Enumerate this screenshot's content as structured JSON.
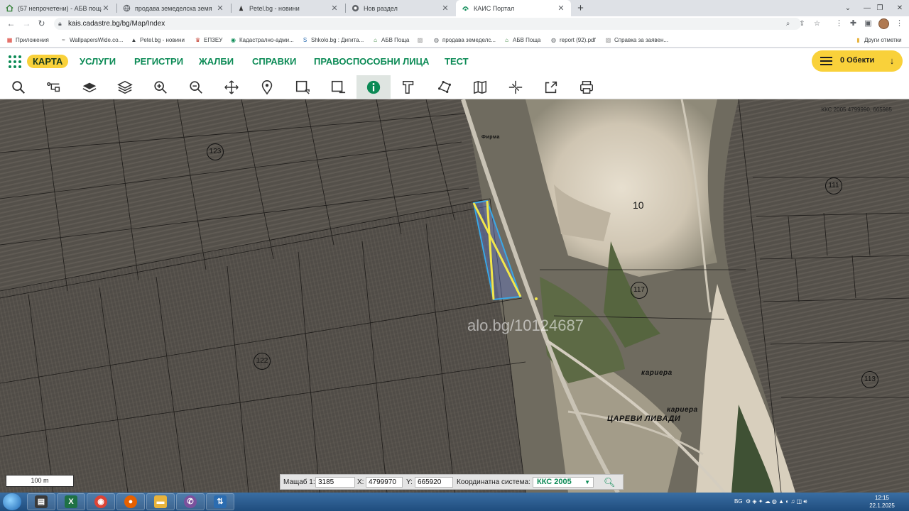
{
  "tabs": [
    {
      "title": "(57 непрочетени) - АБВ поща",
      "icon": "abv-house-icon"
    },
    {
      "title": "продава земеделска земя",
      "icon": "globe-icon"
    },
    {
      "title": "Petel.bg - новини",
      "icon": "petel-icon"
    },
    {
      "title": "Нов раздел",
      "icon": "chrome-icon"
    },
    {
      "title": "КАИС Портал",
      "icon": "kais-icon",
      "active": true
    }
  ],
  "new_tab_label": "+",
  "address": {
    "url": "kais.cadastre.bg/bg/Map/Index"
  },
  "bookmarks": [
    {
      "label": "Приложения",
      "icon": "apps-grid-icon"
    },
    {
      "label": "WallpapersWide.co...",
      "icon": "wallpaper-icon"
    },
    {
      "label": "Petel.bg - новини",
      "icon": "petel-icon"
    },
    {
      "label": "ЕПЗЕУ",
      "icon": "epzeu-icon"
    },
    {
      "label": "Кадастрално-адми...",
      "icon": "cadastre-icon"
    },
    {
      "label": "Shkolo.bg : Дигита...",
      "icon": "shkolo-icon"
    },
    {
      "label": "АБВ Поща",
      "icon": "abv-house-icon"
    },
    {
      "label": "",
      "icon": "broken-image-icon"
    },
    {
      "label": "продава земеделс...",
      "icon": "globe-icon"
    },
    {
      "label": "АБВ Поща",
      "icon": "abv-house-icon"
    },
    {
      "label": "report (92).pdf",
      "icon": "globe-icon"
    },
    {
      "label": "Справка за заявен...",
      "icon": "broken-image-icon"
    }
  ],
  "other_bookmarks": "Други отметки",
  "menu": [
    {
      "label": "КАРТА",
      "active": true
    },
    {
      "label": "УСЛУГИ"
    },
    {
      "label": "РЕГИСТРИ"
    },
    {
      "label": "ЖАЛБИ"
    },
    {
      "label": "СПРАВКИ"
    },
    {
      "label": "ПРАВОСПОСОБНИ ЛИЦА"
    },
    {
      "label": "ТЕСТ"
    }
  ],
  "objects_button": "0 Обекти",
  "tools": [
    "search-icon",
    "layer-tree-icon",
    "layers-icon",
    "layers-stack-icon",
    "zoom-in-icon",
    "zoom-out-icon",
    "pan-arrows-icon",
    "location-pin-icon",
    "select-rectangle-icon",
    "clear-selection-icon",
    "info-icon",
    "measure-area-icon",
    "polygon-icon",
    "map-book-icon",
    "crosshair-icon",
    "export-icon",
    "print-icon"
  ],
  "selected_tool": "info-icon",
  "map": {
    "top_right_coords": "ККС 2005 4799990, 665985",
    "watermark": "alo.bg/10124687",
    "region_labels": [
      "123",
      "111",
      "117",
      "122",
      "113"
    ],
    "big_label": "10",
    "place_labels": [
      "кариера",
      "кариера",
      "ЦАРЕВИ ЛИВАДИ",
      "Фирма"
    ],
    "scale_bar": "100 m"
  },
  "coord_panel": {
    "scale_label": "Мащаб 1:",
    "scale_value": "3185",
    "x_label": "X:",
    "x_value": "4799970",
    "y_label": "Y:",
    "y_value": "665920",
    "system_label": "Координатна система:",
    "system_value": "ККС 2005"
  },
  "taskbar": {
    "apps": [
      "file-explorer-icon",
      "excel-icon",
      "chrome-icon",
      "firefox-icon",
      "folder-icon",
      "viber-icon",
      "network-icon"
    ],
    "language": "BG",
    "time": "12:15",
    "date": "22.1.2025 г."
  },
  "colors": {
    "brand_green": "#0b8a55",
    "accent_yellow": "#f9d13a",
    "selection_blue": "#3aa7e6",
    "selection_yellow": "#f2e64a"
  }
}
